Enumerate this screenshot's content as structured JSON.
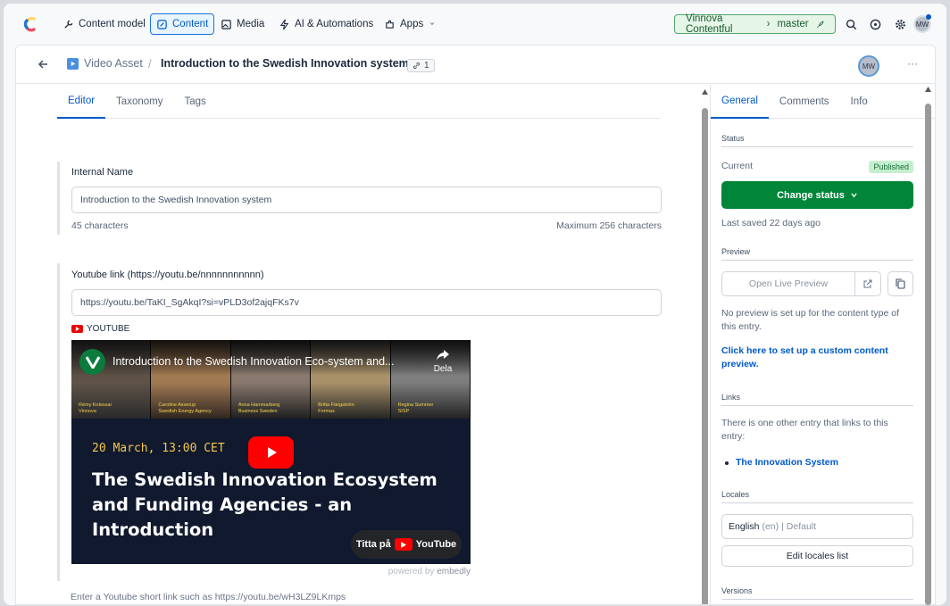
{
  "nav": {
    "content_model": "Content model",
    "content": "Content",
    "media": "Media",
    "ai": "AI & Automations",
    "apps": "Apps",
    "environment": "Vinnova Contentful",
    "branch": "master",
    "avatar": "MW"
  },
  "entry": {
    "content_type": "Video Asset",
    "title": "Introduction to the Swedish Innovation system",
    "references_count": "1",
    "avatar": "MW",
    "more": "···"
  },
  "editor": {
    "tabs": [
      "Editor",
      "Taxonomy",
      "Tags"
    ],
    "internal_name": {
      "label": "Internal Name",
      "value": "Introduction to the Swedish Innovation system",
      "count": "45 characters",
      "max": "Maximum 256 characters"
    },
    "youtube": {
      "label": "Youtube link (https://youtu.be/nnnnnnnnnnn)",
      "value": "https://youtu.be/TaKI_SgAkqI?si=vPLD3of2ajqFKs7v",
      "provider": "YOUTUBE",
      "help": "Enter a Youtube short link such as https://youtu.be/wH3LZ9LKmps"
    },
    "video": {
      "title": "Introduction to the Swedish Innovation Eco-system and...",
      "share": "Dela",
      "people": [
        {
          "name": "Rémy Kolessar",
          "org": "Vinnova"
        },
        {
          "name": "Caroline Asserup",
          "org": "Swedish Energy Agency"
        },
        {
          "name": "Anna Hammarberg",
          "org": "Business Sweden"
        },
        {
          "name": "Britta Fängström",
          "org": "Formas"
        },
        {
          "name": "Regina Summer",
          "org": "SISP"
        }
      ],
      "date": "20 March, 13:00 CET",
      "headline_1": "The Swedish Innovation Ecosystem",
      "headline_2": "and Funding Agencies - an Introduction",
      "watch_on": "Titta på",
      "youtube_brand": "YouTube",
      "powered_by": "powered by",
      "embedly": "embedly"
    }
  },
  "sidebar": {
    "tabs": [
      "General",
      "Comments",
      "Info"
    ],
    "status": {
      "heading": "Status",
      "current_label": "Current",
      "badge": "Published",
      "button": "Change status",
      "last_saved": "Last saved 22 days ago"
    },
    "preview": {
      "heading": "Preview",
      "open": "Open Live Preview",
      "note": "No preview is set up for the content type of this entry.",
      "link": "Click here to set up a custom content preview."
    },
    "links": {
      "heading": "Links",
      "text": "There is one other entry that links to this entry:",
      "items": [
        "The Innovation System"
      ]
    },
    "locales": {
      "heading": "Locales",
      "locale_name": "English",
      "locale_code": "(en)",
      "locale_suffix": "| Default",
      "edit": "Edit locales list"
    },
    "versions": {
      "heading": "Versions"
    }
  }
}
